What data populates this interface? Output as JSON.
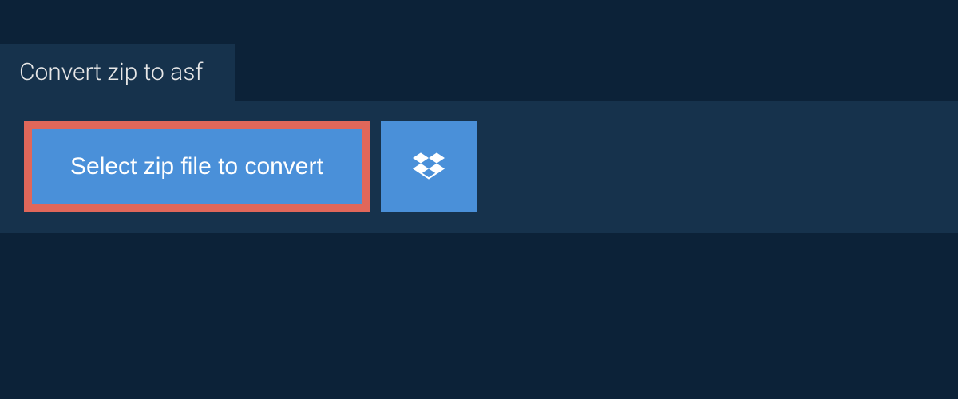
{
  "header": {
    "tab_title": "Convert zip to asf"
  },
  "actions": {
    "select_file_label": "Select zip file to convert",
    "dropbox_icon": "dropbox-icon"
  },
  "colors": {
    "page_bg": "#0c2238",
    "panel_bg": "#16324c",
    "button_bg": "#4a90d9",
    "highlight_border": "#e0675a",
    "text_light": "#e8e8e8",
    "text_white": "#ffffff"
  }
}
